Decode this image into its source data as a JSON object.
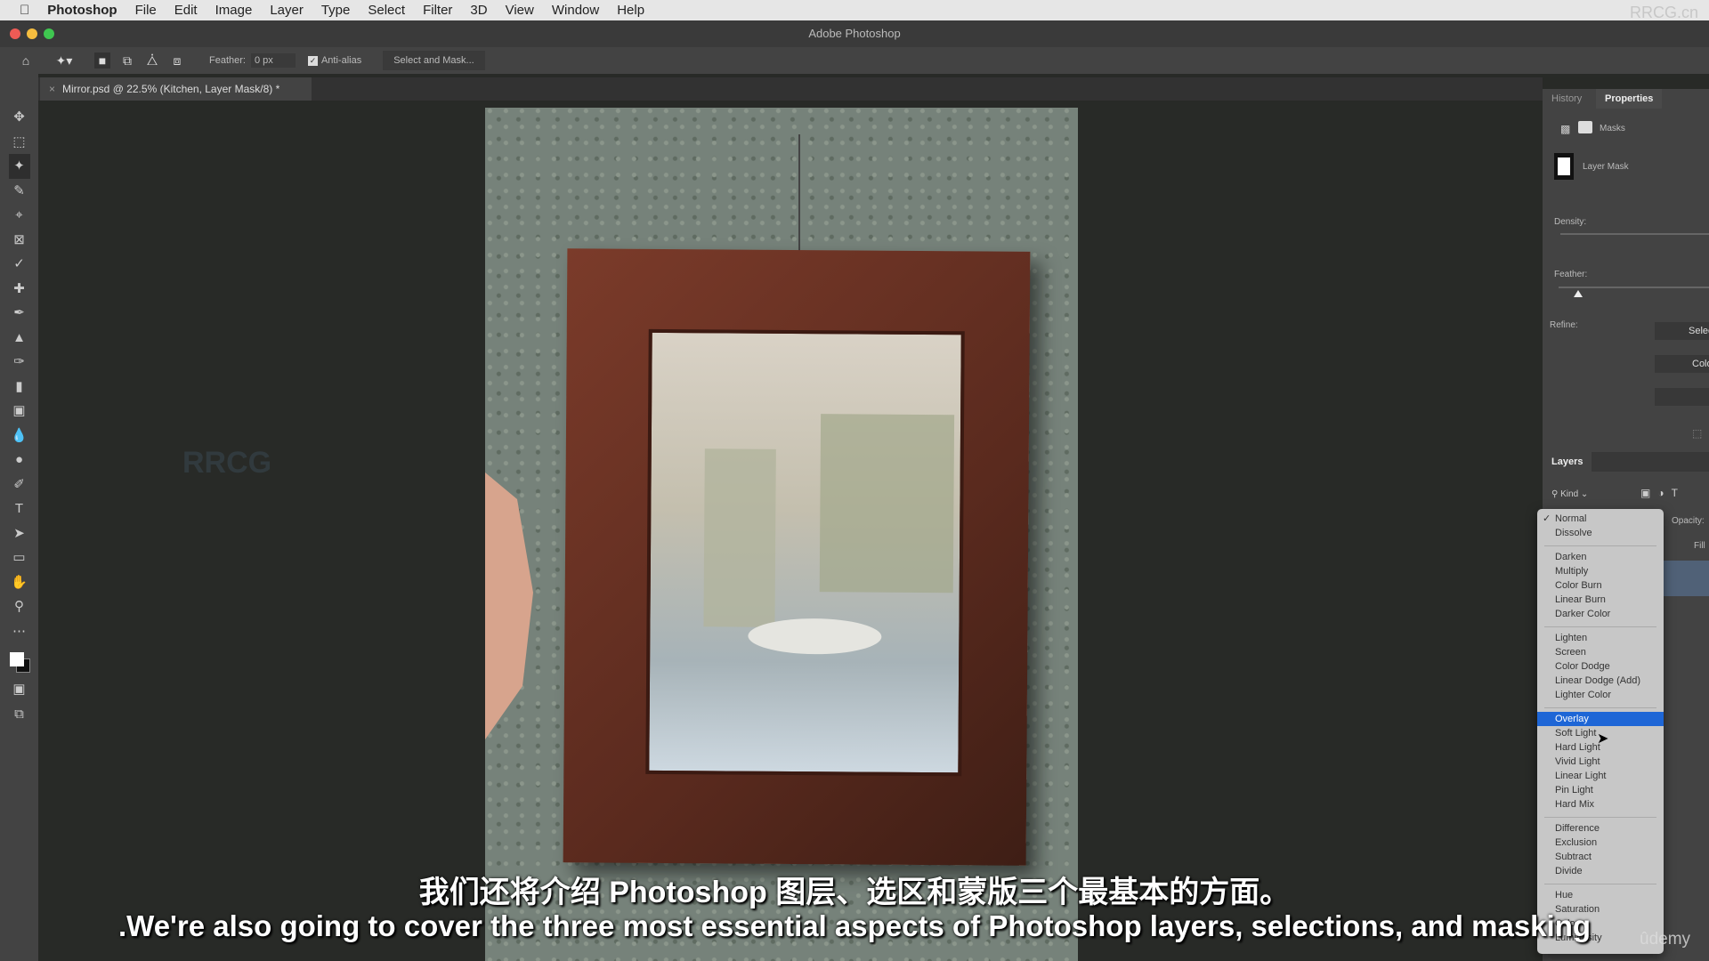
{
  "menubar": {
    "app": "Photoshop",
    "items": [
      "File",
      "Edit",
      "Image",
      "Layer",
      "Type",
      "Select",
      "Filter",
      "3D",
      "View",
      "Window",
      "Help"
    ]
  },
  "window_title": "Adobe Photoshop",
  "options": {
    "feather_label": "Feather:",
    "feather_value": "0 px",
    "antialias_label": "Anti-alias",
    "antialias_checked": true,
    "select_mask": "Select and Mask..."
  },
  "document_tab": "Mirror.psd @ 22.5% (Kitchen, Layer Mask/8) *",
  "properties": {
    "tabs": [
      "History",
      "Properties"
    ],
    "active_tab": "Properties",
    "masks_label": "Masks",
    "layer_mask": "Layer Mask",
    "density_label": "Density:",
    "feather_label": "Feather:",
    "feather_level": 0.1,
    "refine_label": "Refine:",
    "refine_buttons": [
      "Select",
      "Colo"
    ]
  },
  "layers": {
    "title": "Layers",
    "filter": "Kind",
    "opacity_label": "Opacity:",
    "fill_label": "Fill"
  },
  "blend_menu": {
    "checked": "Normal",
    "selected": "Overlay",
    "groups": [
      [
        "Normal",
        "Dissolve"
      ],
      [
        "Darken",
        "Multiply",
        "Color Burn",
        "Linear Burn",
        "Darker Color"
      ],
      [
        "Lighten",
        "Screen",
        "Color Dodge",
        "Linear Dodge (Add)",
        "Lighter Color"
      ],
      [
        "Overlay",
        "Soft Light",
        "Hard Light",
        "Vivid Light",
        "Linear Light",
        "Pin Light",
        "Hard Mix"
      ],
      [
        "Difference",
        "Exclusion",
        "Subtract",
        "Divide"
      ],
      [
        "Hue",
        "Saturation",
        "Color",
        "Luminosity"
      ]
    ]
  },
  "subtitles": {
    "zh": "我们还将介绍 Photoshop 图层、选区和蒙版三个最基本的方面。",
    "en": ".We're also going to cover the three most essential aspects of Photoshop layers, selections, and masking"
  },
  "watermarks": {
    "udemy": "ûdemy",
    "rrcg": "RRCG.cn"
  },
  "colors": {
    "highlight": "#1e66d6",
    "panel": "#434343"
  }
}
